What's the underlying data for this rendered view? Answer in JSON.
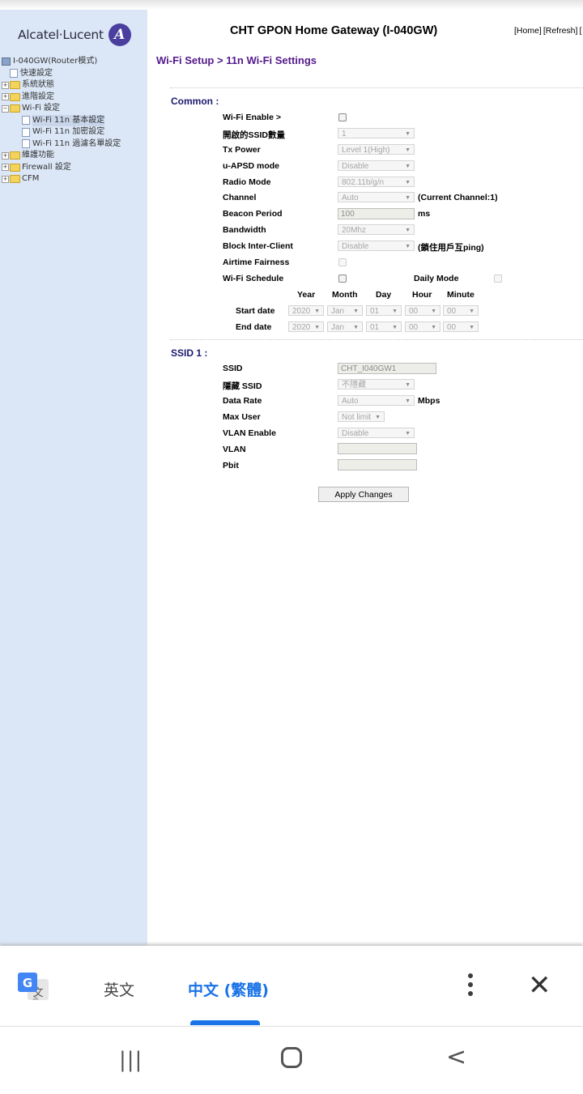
{
  "brand": {
    "name": "Alcatel·Lucent",
    "mark": "A"
  },
  "header": {
    "title": "CHT GPON Home Gateway (I-040GW)",
    "links": [
      "[Home]",
      "[Refresh]",
      "["
    ]
  },
  "breadcrumb": "Wi-Fi Setup > 11n Wi-Fi Settings",
  "sidebar": {
    "root": "I-040GW(Router模式)",
    "items": [
      {
        "label": "快速設定",
        "icon": "page-icon"
      },
      {
        "label": "系統狀態",
        "icon": "folder-icon"
      },
      {
        "label": "進階設定",
        "icon": "folder-icon"
      },
      {
        "label": "Wi-Fi 設定",
        "icon": "folder-open-icon"
      },
      {
        "label": "Wi-Fi 11n 基本設定",
        "icon": "page-icon",
        "selected": true
      },
      {
        "label": "Wi-Fi 11n 加密設定",
        "icon": "page-icon"
      },
      {
        "label": "Wi-Fi 11n 過濾名單設定",
        "icon": "page-icon"
      },
      {
        "label": "維護功能",
        "icon": "folder-icon"
      },
      {
        "label": "Firewall 設定",
        "icon": "folder-icon"
      },
      {
        "label": "CFM",
        "icon": "folder-icon"
      }
    ]
  },
  "common": {
    "title": "Common :",
    "wifi_enable": "Wi-Fi Enable >",
    "ssid_count_label": "開啟的SSID數量",
    "ssid_count_value": "1",
    "tx_power_label": "Tx Power",
    "tx_power_value": "Level 1(High)",
    "uapsd_label": "u-APSD mode",
    "uapsd_value": "Disable",
    "radio_mode_label": "Radio Mode",
    "radio_mode_value": "802.11b/g/n",
    "channel_label": "Channel",
    "channel_value": "Auto",
    "channel_note": "(Current Channel:1)",
    "beacon_label": "Beacon Period",
    "beacon_value": "100",
    "beacon_unit": "ms",
    "bandwidth_label": "Bandwidth",
    "bandwidth_value": "20Mhz",
    "block_label": "Block Inter-Client",
    "block_value": "Disable",
    "block_note": "(鎖住用戶互ping)",
    "airtime_label": "Airtime Fairness",
    "schedule_label": "Wi-Fi Schedule",
    "daily_mode_label": "Daily Mode",
    "schedule_headers": [
      "Year",
      "Month",
      "Day",
      "Hour",
      "Minute"
    ],
    "start_label": "Start date",
    "end_label": "End date",
    "start": [
      "2020",
      "Jan",
      "01",
      "00",
      "00"
    ],
    "end": [
      "2020",
      "Jan",
      "01",
      "00",
      "00"
    ]
  },
  "ssid1": {
    "title": "SSID 1 :",
    "ssid_label": "SSID",
    "ssid_value": "CHT_I040GW1",
    "hide_label": "隱藏 SSID",
    "hide_value": "不隱藏",
    "rate_label": "Data Rate",
    "rate_value": "Auto",
    "rate_unit": "Mbps",
    "maxuser_label": "Max User",
    "maxuser_value": "Not limit",
    "vlan_enable_label": "VLAN Enable",
    "vlan_enable_value": "Disable",
    "vlan_label": "VLAN",
    "pbit_label": "Pbit"
  },
  "apply_label": "Apply Changes",
  "translate_bar": {
    "tab_source": "英文",
    "tab_target": "中文 (繁體)"
  },
  "colors": {
    "accent": "#1a73e8",
    "sidebar_bg": "#dbe7f7",
    "breadcrumb": "#54198b",
    "section": "#1a1a6e"
  }
}
